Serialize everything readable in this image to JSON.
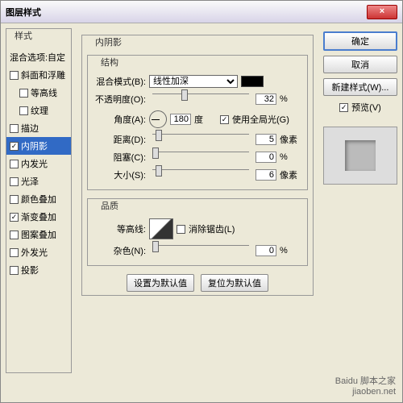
{
  "window": {
    "title": "图层样式"
  },
  "left": {
    "header": "样式",
    "blend_header": "混合选项:自定",
    "items": [
      {
        "label": "斜面和浮雕",
        "checked": false
      },
      {
        "label": "等高线",
        "checked": false,
        "indent": true
      },
      {
        "label": "纹理",
        "checked": false,
        "indent": true
      },
      {
        "label": "描边",
        "checked": false
      },
      {
        "label": "内阴影",
        "checked": true,
        "selected": true
      },
      {
        "label": "内发光",
        "checked": false
      },
      {
        "label": "光泽",
        "checked": false
      },
      {
        "label": "颜色叠加",
        "checked": false
      },
      {
        "label": "渐变叠加",
        "checked": true
      },
      {
        "label": "图案叠加",
        "checked": false
      },
      {
        "label": "外发光",
        "checked": false
      },
      {
        "label": "投影",
        "checked": false
      }
    ]
  },
  "mid": {
    "title": "内阴影",
    "structure": {
      "title": "结构",
      "blend_label": "混合模式(B):",
      "blend_value": "线性加深",
      "opacity_label": "不透明度(O):",
      "opacity_val": "32",
      "opacity_unit": "%",
      "angle_label": "角度(A):",
      "angle_val": "180",
      "angle_unit": "度",
      "global_label": "使用全局光(G)",
      "global_checked": true,
      "distance_label": "距离(D):",
      "distance_val": "5",
      "distance_unit": "像素",
      "choke_label": "阻塞(C):",
      "choke_val": "0",
      "choke_unit": "%",
      "size_label": "大小(S):",
      "size_val": "6",
      "size_unit": "像素"
    },
    "quality": {
      "title": "品质",
      "contour_label": "等高线:",
      "anti_label": "消除锯齿(L)",
      "anti_checked": false,
      "noise_label": "杂色(N):",
      "noise_val": "0",
      "noise_unit": "%"
    },
    "defaults": {
      "set": "设置为默认值",
      "reset": "复位为默认值"
    }
  },
  "right": {
    "ok": "确定",
    "cancel": "取消",
    "new_style": "新建样式(W)...",
    "preview_label": "预览(V)",
    "preview_checked": true
  },
  "watermark": {
    "l1": "Baidu 脚本之家",
    "l2": "jiaoben.net"
  }
}
